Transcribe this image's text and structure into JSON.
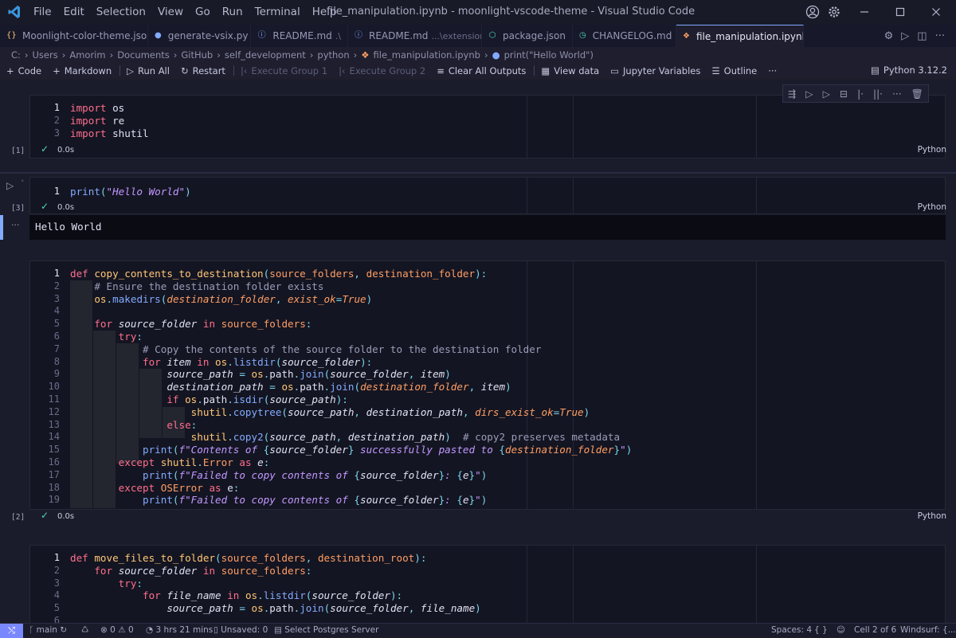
{
  "titlebar": {
    "menus": [
      "File",
      "Edit",
      "Selection",
      "View",
      "Go",
      "Run",
      "Terminal",
      "Help"
    ],
    "title": "file_manipulation.ipynb - moonlight-vscode-theme - Visual Studio Code"
  },
  "tabs": [
    {
      "label": "Moonlight-color-theme.json",
      "icon": "json-icon",
      "sub": ""
    },
    {
      "label": "generate-vsix.py",
      "icon": "python-icon",
      "sub": ""
    },
    {
      "label": "README.md",
      "icon": "info-icon",
      "sub": ".\\"
    },
    {
      "label": "README.md",
      "icon": "info-icon",
      "sub": "...\\extension"
    },
    {
      "label": "package.json",
      "icon": "package-icon",
      "sub": ""
    },
    {
      "label": "CHANGELOG.md",
      "icon": "history-icon",
      "sub": ""
    },
    {
      "label": "file_manipulation.ipynb",
      "icon": "notebook-icon",
      "sub": "",
      "active": true
    }
  ],
  "breadcrumb": [
    "C:",
    "Users",
    "Amorim",
    "Documents",
    "GitHub",
    "self_development",
    "python",
    "file_manipulation.ipynb",
    "print(\"Hello World\")"
  ],
  "toolbar": {
    "code": "Code",
    "markdown": "Markdown",
    "run_all": "Run All",
    "restart": "Restart",
    "exec_group_1": "Execute Group 1",
    "exec_group_2": "Execute Group 2",
    "clear_outputs": "Clear All Outputs",
    "view_data": "View data",
    "jupyter_vars": "Jupyter Variables",
    "outline": "Outline",
    "more": "···",
    "kernel": "Python 3.12.2"
  },
  "cells": [
    {
      "exec": "[1]",
      "status": "0.0s",
      "lang": "Python"
    },
    {
      "exec": "[3]",
      "status": "0.0s",
      "lang": "Python",
      "output": "Hello World"
    },
    {
      "exec": "[2]",
      "status": "0.0s",
      "lang": "Python"
    },
    {
      "exec": "",
      "status": "",
      "lang": ""
    }
  ],
  "statusbar": {
    "branch": "main",
    "problems": "0",
    "warnings": "0",
    "time": "3 hrs 21 mins",
    "unsaved": "Unsaved: 0",
    "postgres": "Select Postgres Server",
    "spaces": "Spaces: 4",
    "braces": "{ }",
    "cell": "Cell 2 of 6",
    "windsurf": "Windsurf: {...}"
  },
  "colors": {
    "accent": "#82aaff",
    "keyword": "#ff6f8d",
    "function": "#ffc777",
    "string": "#c099ff",
    "param": "#ff9e64",
    "success": "#4fd6be"
  }
}
